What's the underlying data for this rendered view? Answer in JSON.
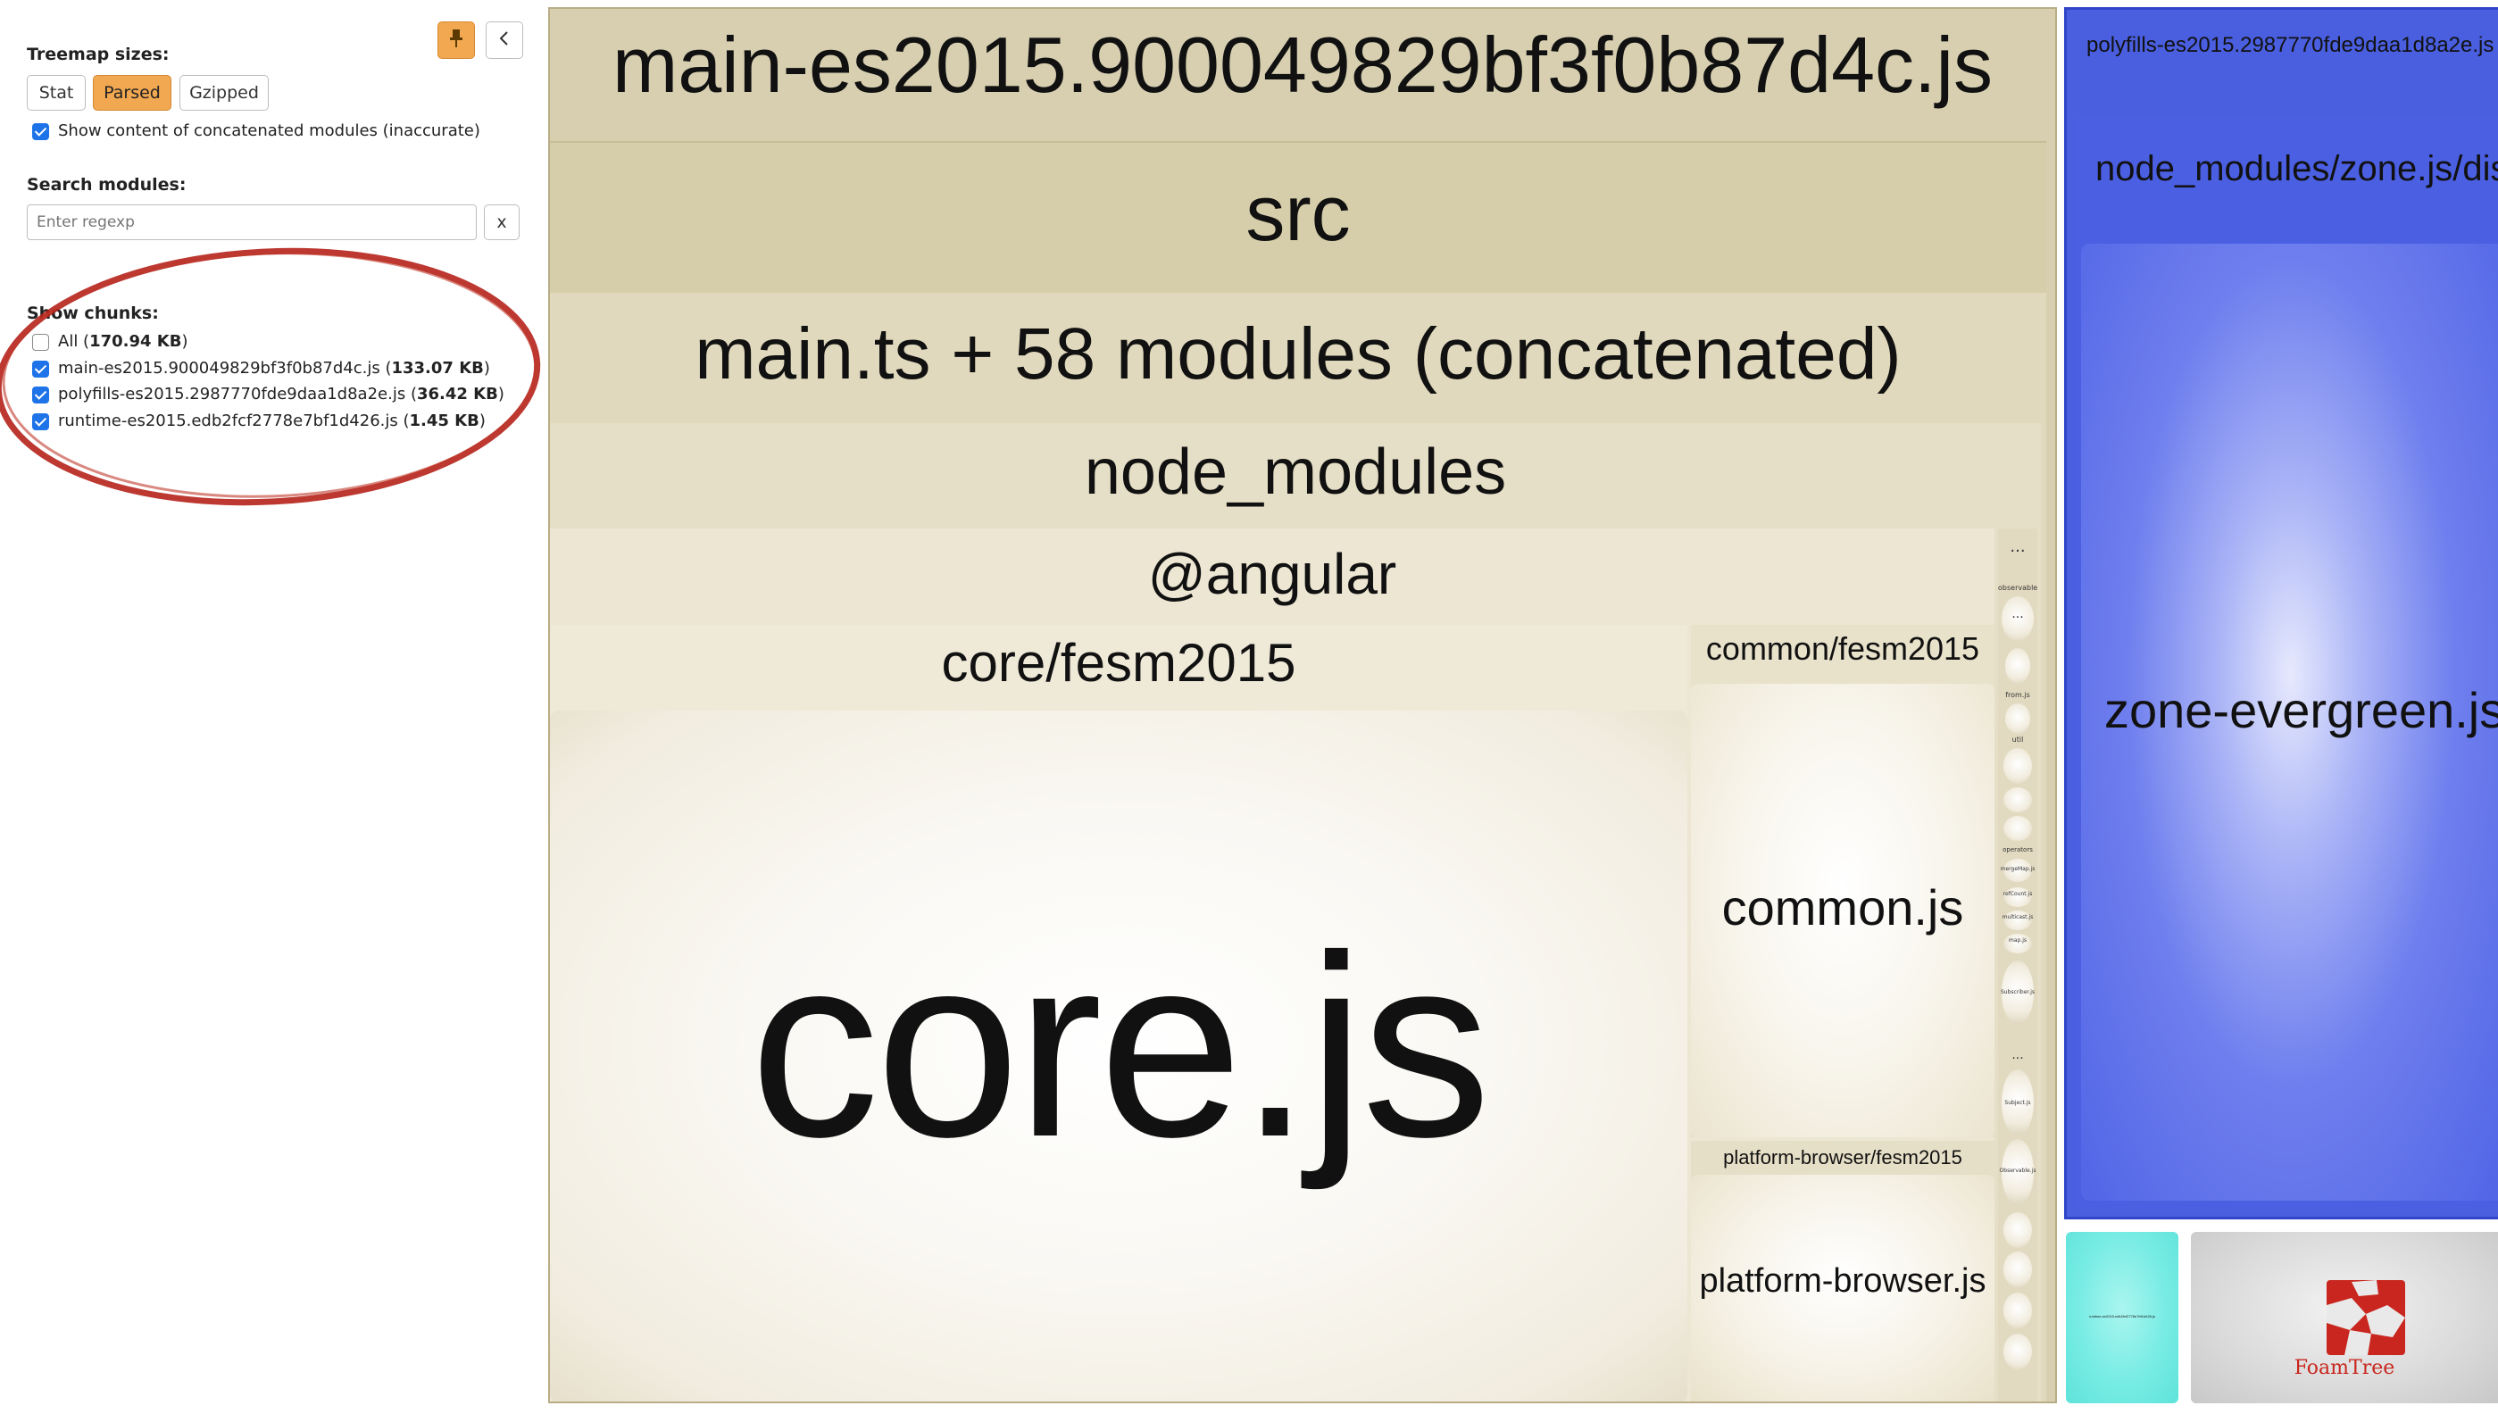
{
  "sidebar": {
    "pin_icon": "pin-icon",
    "collapse_icon": "chevron-left-icon",
    "treemap_sizes_label": "Treemap sizes:",
    "size_buttons": [
      "Stat",
      "Parsed",
      "Gzipped"
    ],
    "active_size": "Parsed",
    "show_concatenated_label": "Show content of concatenated modules (inaccurate)",
    "show_concatenated_checked": true,
    "search_label": "Search modules:",
    "search_placeholder": "Enter regexp",
    "search_value": "",
    "search_clear_label": "x",
    "show_chunks_label": "Show chunks:",
    "chunks": [
      {
        "name": "All",
        "size": "170.94 KB",
        "checked": false
      },
      {
        "name": "main-es2015.900049829bf3f0b87d4c.js",
        "size": "133.07 KB",
        "checked": true
      },
      {
        "name": "polyfills-es2015.2987770fde9daa1d8a2e.js",
        "size": "36.42 KB",
        "checked": true
      },
      {
        "name": "runtime-es2015.edb2fcf2778e7bf1d426.js",
        "size": "1.45 KB",
        "checked": true
      }
    ],
    "annotation_color": "#b5221b"
  },
  "treemap": {
    "main": {
      "title": "main-es2015.900049829bf3f0b87d4c.js",
      "src": "src",
      "concat": "main.ts + 58 modules (concatenated)",
      "node_modules": "node_modules",
      "angular": "@angular",
      "core_group": "core/fesm2015",
      "core_file": "core.js",
      "common_group": "common/fesm2015",
      "common_file": "common.js",
      "platform_group": "platform-browser/fesm2015",
      "platform_file": "platform-browser.js",
      "more": "...",
      "rx_labels": [
        "observable",
        "from.js",
        "util",
        "operators",
        "mergeMap.js",
        "refCount.js",
        "multicast.js",
        "map.js",
        "Subscriber.js",
        "Subject.js",
        "Observable.js"
      ]
    },
    "polyfills": {
      "title": "polyfills-es2015.2987770fde9daa1d8a2e.js",
      "path": "node_modules/zone.js/dist",
      "file": "zone-evergreen.js"
    },
    "runtime": {
      "title": "runtime-es2015.edb2fcf2778e7bf1d426.js"
    },
    "branding": {
      "name": "FoamTree",
      "color": "#c8261e"
    },
    "colors": {
      "main": "#d8cfae",
      "polyfills": "#4a5fe0",
      "runtime": "#6ee8e0",
      "accent": "#f2a851"
    }
  }
}
